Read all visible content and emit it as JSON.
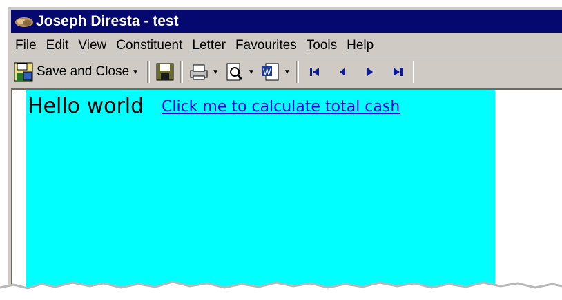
{
  "window": {
    "title": "Joseph Diresta - test"
  },
  "menu": [
    {
      "label": "File",
      "key": "F",
      "rest": "ile"
    },
    {
      "label": "Edit",
      "key": "E",
      "rest": "dit"
    },
    {
      "label": "View",
      "key": "V",
      "rest": "iew"
    },
    {
      "label": "Constituent",
      "key": "C",
      "rest": "onstituent"
    },
    {
      "label": "Letter",
      "key": "L",
      "rest": "etter"
    },
    {
      "label": "Favourites",
      "pre": "F",
      "key": "a",
      "rest": "vourites"
    },
    {
      "label": "Tools",
      "key": "T",
      "rest": "ools"
    },
    {
      "label": "Help",
      "key": "H",
      "rest": "elp"
    }
  ],
  "toolbar": {
    "save_close_label": "Save and Close",
    "icons": [
      "save-close-icon",
      "floppy-disk-icon",
      "print-icon",
      "print-preview-icon",
      "word-icon",
      "first-record-icon",
      "previous-record-icon",
      "next-record-icon",
      "last-record-icon"
    ]
  },
  "content": {
    "greeting": "Hello world",
    "link_text": "Click me to calculate total cash",
    "highlight_color": "#00ffff",
    "link_color": "#0000ee"
  }
}
